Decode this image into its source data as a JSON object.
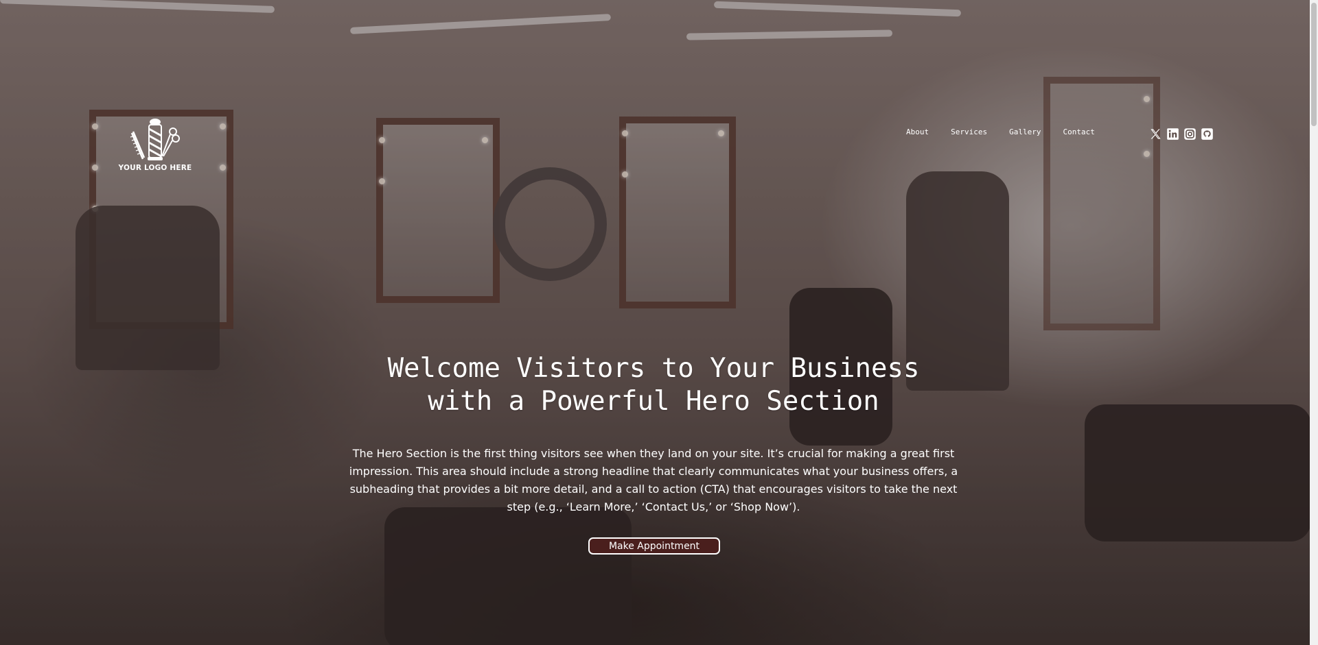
{
  "brand": {
    "logo_text": "YOUR LOGO HERE"
  },
  "nav": {
    "items": [
      {
        "label": "About"
      },
      {
        "label": "Services"
      },
      {
        "label": "Gallery"
      },
      {
        "label": "Contact"
      }
    ]
  },
  "social": {
    "icons": [
      "x-icon",
      "linkedin-icon",
      "instagram-icon",
      "github-icon"
    ]
  },
  "hero": {
    "headline_line1": "Welcome Visitors to Your Business",
    "headline_line2": "with a Powerful Hero Section",
    "subheading": "The Hero Section is the first thing visitors see when they land on your site. It’s crucial for making a great first impression. This area should include a strong headline that clearly communicates what your business offers, a subheading that provides a bit more detail, and a call to action (CTA) that encourages visitors to take the next step (e.g., ‘Learn More,’ ‘Contact Us,’ or ‘Shop Now’).",
    "cta_label": "Make Appointment"
  },
  "colors": {
    "cta_background": "#4a1f1d",
    "text": "#ffffff"
  }
}
